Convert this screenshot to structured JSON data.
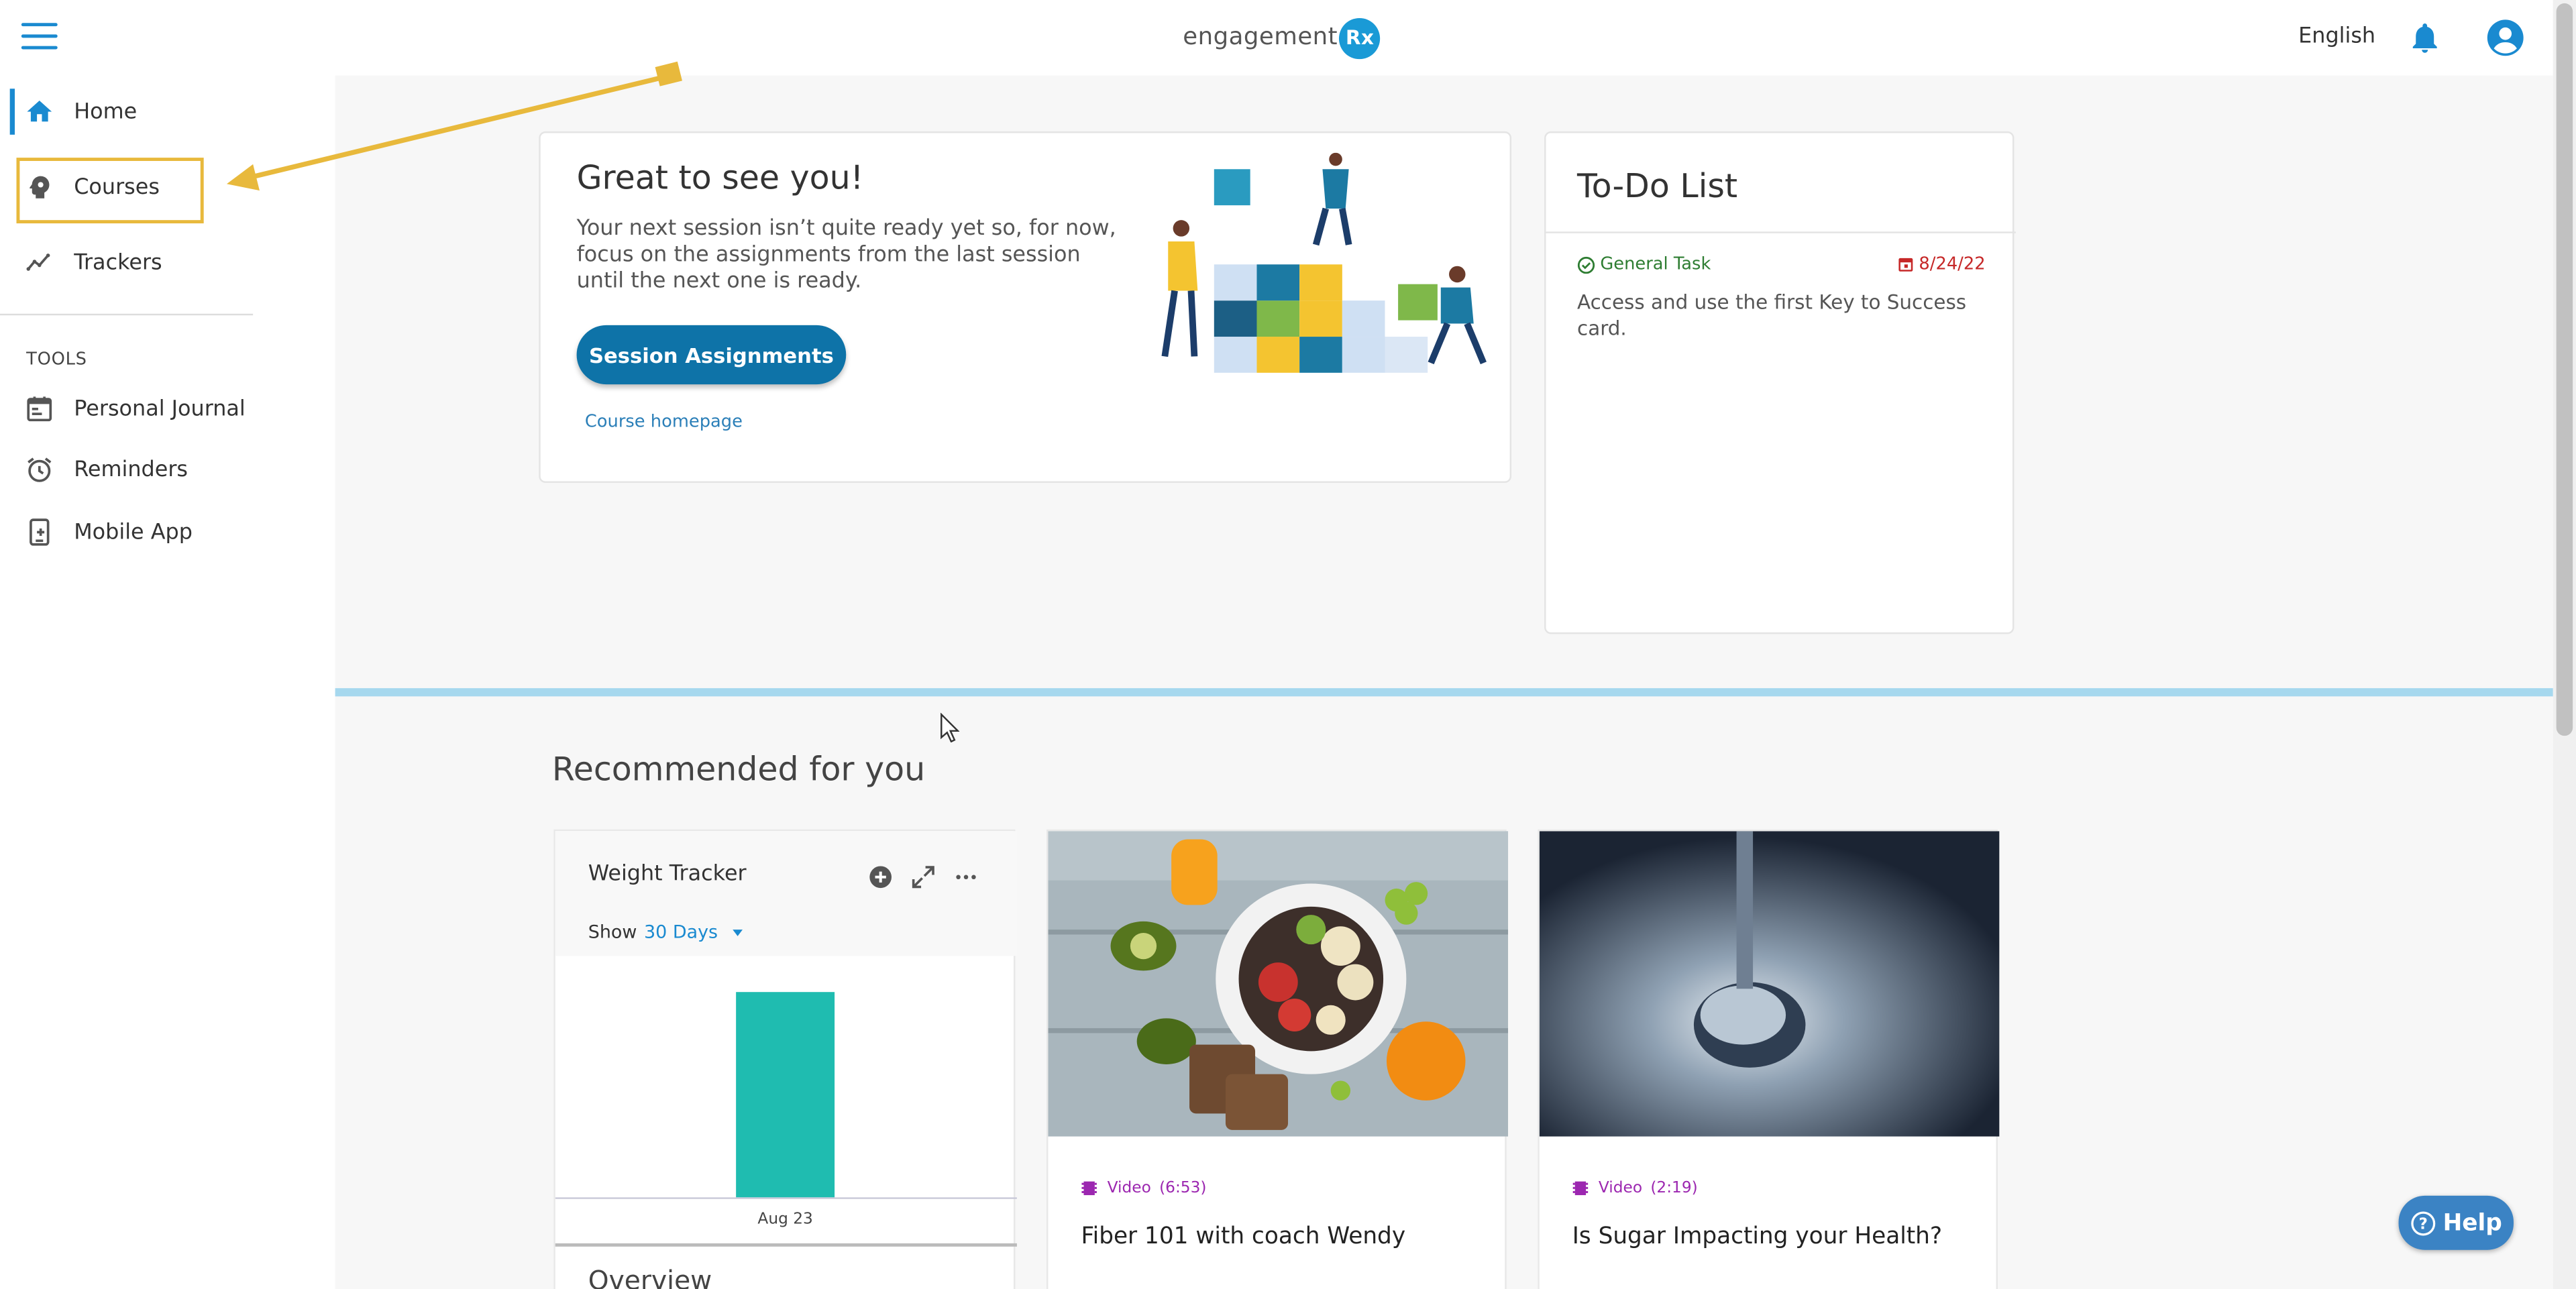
{
  "header": {
    "logo_text": "engagement",
    "logo_badge": "Rx",
    "language": "English"
  },
  "sidebar": {
    "items": [
      {
        "label": "Home",
        "icon": "home-icon",
        "active": true
      },
      {
        "label": "Courses",
        "icon": "courses-icon",
        "highlighted": true
      },
      {
        "label": "Trackers",
        "icon": "trackers-icon"
      }
    ],
    "tools_label": "TOOLS",
    "tools": [
      {
        "label": "Personal Journal",
        "icon": "journal-icon"
      },
      {
        "label": "Reminders",
        "icon": "alarm-clock-icon"
      },
      {
        "label": "Mobile App",
        "icon": "mobile-app-icon"
      }
    ]
  },
  "welcome": {
    "title": "Great to see you!",
    "text": "Your next session isn’t quite ready yet so, for now, focus on the assignments from the last session until the next one is ready.",
    "button": "Session Assignments",
    "link": "Course homepage"
  },
  "todo": {
    "title": "To-Do List",
    "tag": "General Task",
    "date": "8/24/22",
    "description": "Access and use the first Key to Success card."
  },
  "recommended": {
    "title": "Recommended for you",
    "tracker": {
      "name": "Weight Tracker",
      "show_label": "Show",
      "range": "30 Days",
      "overview": "Overview"
    },
    "media": [
      {
        "type": "Video",
        "duration": "(6:53)",
        "title": "Fiber 101 with coach Wendy"
      },
      {
        "type": "Video",
        "duration": "(2:19)",
        "title": "Is Sugar Impacting your Health?"
      }
    ]
  },
  "help": {
    "label": "Help"
  },
  "chart_data": {
    "type": "bar",
    "categories": [
      "Aug 23"
    ],
    "values": [
      1
    ],
    "title": "",
    "xlabel": "",
    "ylabel": ""
  },
  "colors": {
    "accent": "#1a8ad0",
    "button": "#0e73a8",
    "bar": "#1fbcb0",
    "highlight": "#e8b93c",
    "task_green": "#2e7d32",
    "date_red": "#c62828",
    "video_purple": "#9c27b0"
  }
}
